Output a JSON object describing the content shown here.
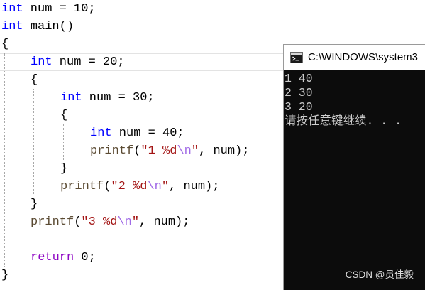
{
  "editor": {
    "lines": [
      [
        "int",
        " num = 10;"
      ],
      [
        "int",
        " main()"
      ],
      [
        "{"
      ],
      [
        "int",
        " num = 20;"
      ],
      [
        "{"
      ],
      [
        "int",
        " num = 30;"
      ],
      [
        "{"
      ],
      [
        "int",
        " num = 40;"
      ],
      [
        "printf",
        "(",
        "\"1 %d",
        "\\n",
        "\"",
        ", num);"
      ],
      [
        "}"
      ],
      [
        "printf",
        "(",
        "\"2 %d",
        "\\n",
        "\"",
        ", num);"
      ],
      [
        "}"
      ],
      [
        "printf",
        "(",
        "\"3 %d",
        "\\n",
        "\"",
        ", num);"
      ],
      [],
      [
        "return",
        " 0;"
      ],
      [
        "}"
      ]
    ]
  },
  "console": {
    "icon": "console-app-icon",
    "title": "C:\\WINDOWS\\system3",
    "output": [
      "1 40",
      "2 30",
      "3 20",
      "请按任意键继续. . ."
    ]
  },
  "watermark": {
    "text": "CSDN @员佳毅"
  },
  "colors": {
    "editor_background": "#ffffff",
    "plain": "#000000",
    "keyword": "#0000ff",
    "control_keyword": "#8f08c4",
    "function": "#5a4a32",
    "string": "#a31515",
    "escape": "#a06ae6",
    "console_background": "#0c0c0c",
    "console_text": "#cccccc",
    "watermark": "#dcdcdc"
  }
}
